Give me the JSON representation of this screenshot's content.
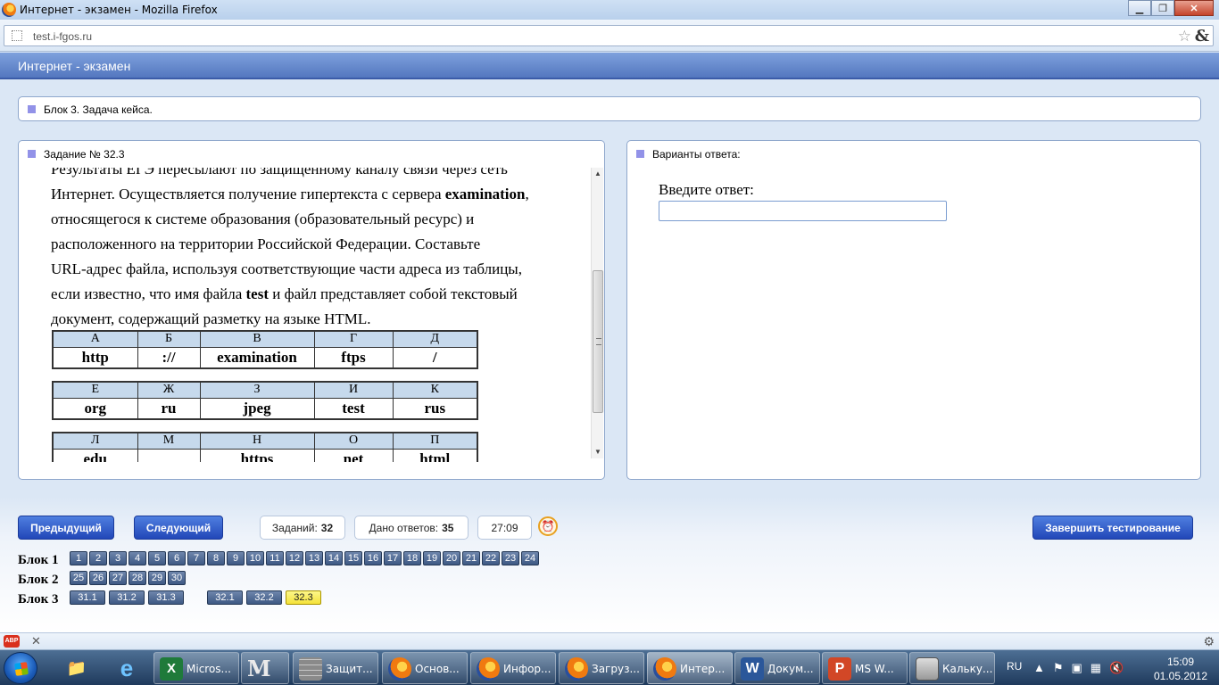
{
  "browser": {
    "window_title": "Интернет - экзамен - Mozilla Firefox",
    "url": "test.i-fgos.ru",
    "star_icon": "bookmark-star-icon",
    "menu_icon": "&"
  },
  "app": {
    "header_title": "Интернет - экзамен",
    "block_title": "Блок 3. Задача кейса.",
    "task_title": "Задание № 32.3",
    "answers_title": "Варианты ответа:"
  },
  "task": {
    "line1": "Результаты ЕГЭ пересылают по защищенному каналу связи через сеть",
    "line2a": "Интернет. Осуществляется получение гипертекста с сервера ",
    "line2b": "examination",
    "line2c": ",",
    "line3": "относящегося к системе образования (образовательный ресурс) и",
    "line4": "расположенного на территории Российской Федерации. Составьте",
    "line5": "URL-адрес файла, используя соответствующие части адреса из таблицы,",
    "line6a": "если известно, что имя файла ",
    "line6b": "test",
    "line6c": " и файл представляет собой текстовый",
    "line7": "документ, содержащий разметку на языке HTML.",
    "tables": [
      {
        "headers": [
          "А",
          "Б",
          "В",
          "Г",
          "Д"
        ],
        "values": [
          "http",
          "://",
          "examination",
          "ftps",
          "/"
        ]
      },
      {
        "headers": [
          "Е",
          "Ж",
          "З",
          "И",
          "К"
        ],
        "values": [
          "org",
          "ru",
          "jpeg",
          "test",
          "rus"
        ]
      },
      {
        "headers": [
          "Л",
          "М",
          "Н",
          "О",
          "П"
        ],
        "values": [
          "edu",
          "",
          "https",
          "net",
          "html"
        ]
      }
    ]
  },
  "answer": {
    "label": "Введите ответ:",
    "value": ""
  },
  "controls": {
    "prev": "Предыдущий",
    "next": "Следующий",
    "tasks_label": "Заданий:",
    "tasks_value": "32",
    "answers_label": "Дано ответов:",
    "answers_value": "35",
    "timer": "27:09",
    "finish": "Завершить тестирование"
  },
  "nav": {
    "block1_label": "Блок 1",
    "block2_label": "Блок 2",
    "block3_label": "Блок 3",
    "block1": [
      "1",
      "2",
      "3",
      "4",
      "5",
      "6",
      "7",
      "8",
      "9",
      "10",
      "11",
      "12",
      "13",
      "14",
      "15",
      "16",
      "17",
      "18",
      "19",
      "20",
      "21",
      "22",
      "23",
      "24"
    ],
    "block2": [
      "25",
      "26",
      "27",
      "28",
      "29",
      "30"
    ],
    "block3": [
      "31.1",
      "31.2",
      "31.3",
      "32.1",
      "32.2",
      "32.3"
    ],
    "active": "32.3"
  },
  "taskbar": {
    "buttons": [
      "Micros...",
      "",
      "Защит...",
      "Основ...",
      "Инфор...",
      "Загруз...",
      "Интер...",
      "Докум...",
      "MS W...",
      "Кальку..."
    ],
    "lang": "RU",
    "time": "15:09",
    "date": "01.05.2012"
  }
}
